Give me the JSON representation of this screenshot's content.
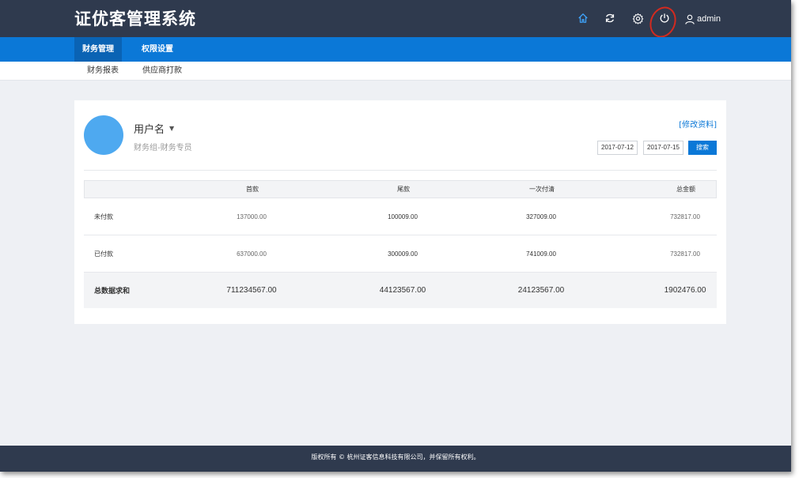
{
  "app": {
    "title": "证优客管理系统"
  },
  "toolbar": {
    "icons": [
      "home-icon",
      "refresh-icon",
      "gear-icon",
      "power-icon",
      "user-icon"
    ],
    "username": "admin",
    "accent": "#0b78d7"
  },
  "nav": {
    "items": [
      {
        "label": "财务管理",
        "active": true
      },
      {
        "label": "权限设置",
        "active": false
      }
    ]
  },
  "subnav": {
    "items": [
      {
        "label": "财务报表"
      },
      {
        "label": "供应商打款"
      }
    ]
  },
  "profile": {
    "name": "用户名",
    "role": "财务组-财务专员",
    "edit_label": "[修改资料]"
  },
  "search": {
    "start_date": "2017-07-12",
    "end_date": "2017-07-15",
    "button_label": "搜索"
  },
  "table": {
    "headers": [
      "",
      "首款",
      "尾款",
      "一次付清",
      "总金额"
    ],
    "rows": [
      {
        "label": "未付款",
        "values": [
          "137000.00",
          "100009.00",
          "327009.00",
          "732817.00"
        ]
      },
      {
        "label": "已付款",
        "values": [
          "637000.00",
          "300009.00",
          "741009.00",
          "732817.00"
        ]
      }
    ],
    "total": {
      "label": "总数据求和",
      "values": [
        "711234567.00",
        "44123567.00",
        "24123567.00",
        "1902476.00"
      ]
    }
  },
  "footer": {
    "text": "版权所有 © 杭州证客信息科技有限公司，并保留所有权利。"
  }
}
